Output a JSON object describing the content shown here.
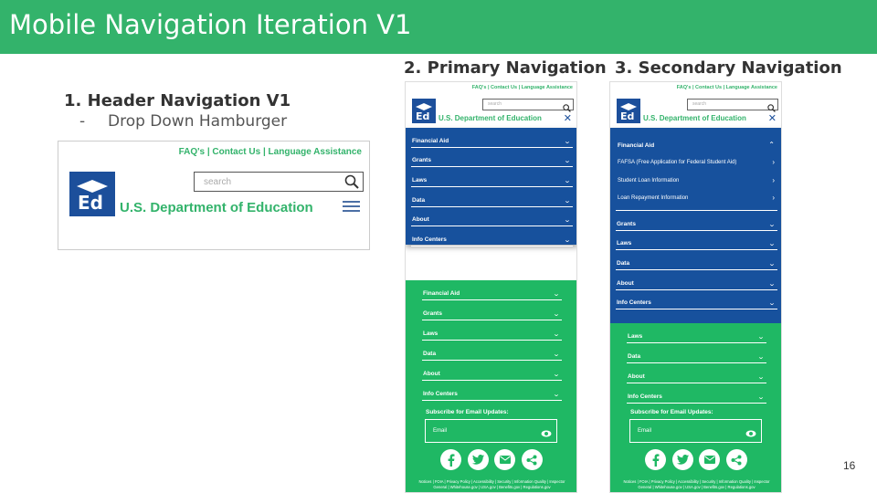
{
  "slide": {
    "title": "Mobile Navigation Iteration V1",
    "page_number": "16",
    "colors": {
      "title_bar": "#33b36b",
      "nav_blue": "#17519d",
      "footer_green": "#1fb864",
      "brand_green": "#33b36b"
    }
  },
  "section1": {
    "heading": "1. Header Navigation V1",
    "bullet_dash": "-",
    "bullet": "Drop Down Hamburger"
  },
  "section2": {
    "heading": "2. Primary Navigation"
  },
  "section3": {
    "heading": "3. Secondary Navigation"
  },
  "header_mock": {
    "links": "FAQ's | Contact Us | Language Assistance",
    "search_placeholder": "search",
    "logo_text": "Ed",
    "department": "U.S. Department of Education"
  },
  "phone": {
    "links": "FAQ's | Contact Us | Language Assistance",
    "search_placeholder": "search",
    "logo_text": "Ed",
    "department": "U.S. Department of Education",
    "close": "✕"
  },
  "primary_menu": [
    "Financial Aid",
    "Grants",
    "Laws",
    "Data",
    "About",
    "Info Centers"
  ],
  "secondary_menu": {
    "expanded": "Financial Aid",
    "sub_items": [
      "FAFSA (Free Application for Federal Student Aid)",
      "Student Loan Information",
      "Loan Repayment Information"
    ],
    "others": [
      "Grants",
      "Laws",
      "Data",
      "About",
      "Info Centers"
    ]
  },
  "footer_menu_primary": [
    "Financial Aid",
    "Grants",
    "Laws",
    "Data",
    "About",
    "Info Centers"
  ],
  "footer_menu_secondary": [
    "Laws",
    "Data",
    "About",
    "Info Centers"
  ],
  "footer": {
    "subscribe_label": "Subscribe for Email Updates:",
    "email_placeholder": "Email",
    "social_icons": [
      "facebook-icon",
      "twitter-icon",
      "email-icon",
      "share-icon"
    ],
    "links_line1": "Notices | FOIA | Privacy Policy | Accessibility | Security | Information Quality | Inspector",
    "links_line2": "General | Whitehouse.gov | USA.gov | Benefits.gov | Regulations.gov"
  }
}
